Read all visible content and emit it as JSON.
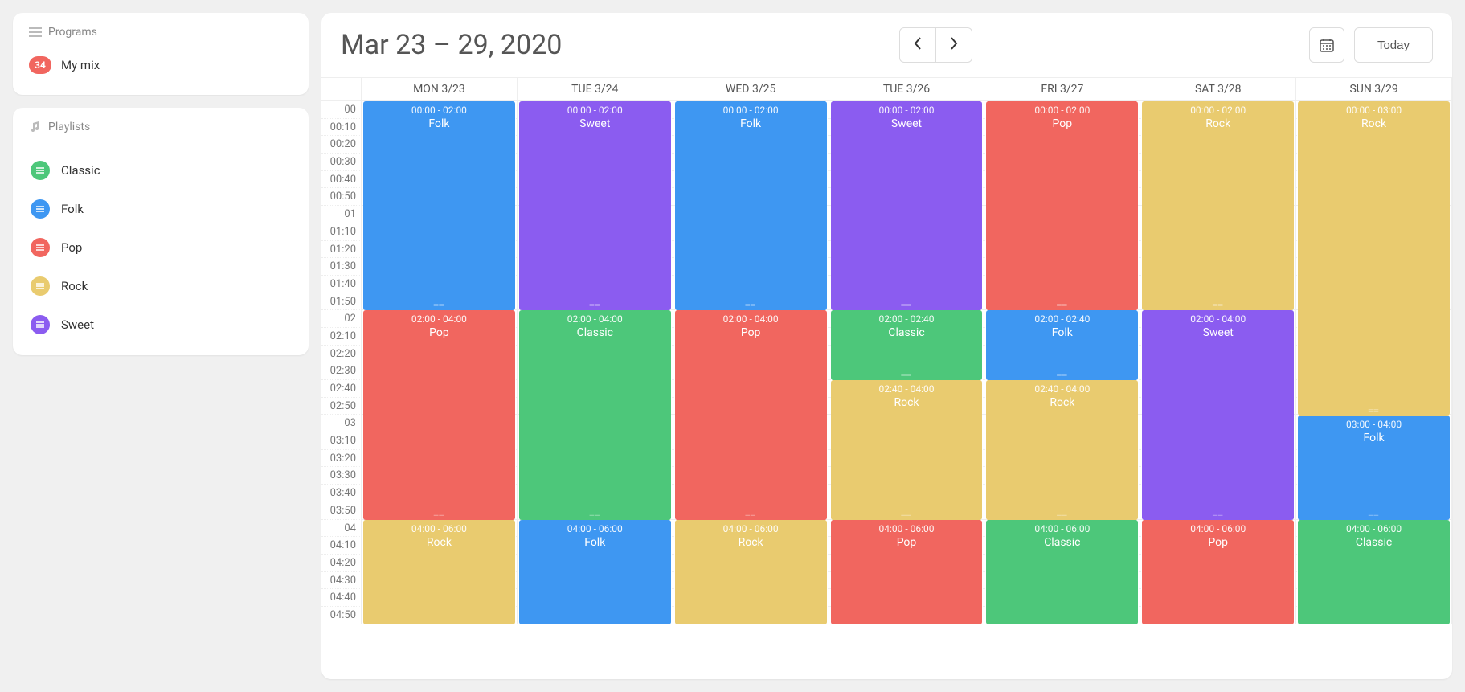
{
  "sidebar": {
    "programs_header": "Programs",
    "programs": [
      {
        "badge": "34",
        "label": "My mix"
      }
    ],
    "playlists_header": "Playlists",
    "playlists": [
      {
        "label": "Classic",
        "color": "#4dc77a"
      },
      {
        "label": "Folk",
        "color": "#3e97f2"
      },
      {
        "label": "Pop",
        "color": "#f1665f"
      },
      {
        "label": "Rock",
        "color": "#e9cb6f"
      },
      {
        "label": "Sweet",
        "color": "#8b5cf0"
      }
    ]
  },
  "calendar": {
    "range_title": "Mar 23 – 29, 2020",
    "today_label": "Today",
    "colors": {
      "Classic": "#4dc77a",
      "Folk": "#3e97f2",
      "Pop": "#f1665f",
      "Rock": "#e9cb6f",
      "Sweet": "#8b5cf0"
    },
    "days": [
      "MON 3/23",
      "TUE 3/24",
      "WED 3/25",
      "TUE 3/26",
      "FRI 3/27",
      "SAT 3/28",
      "SUN 3/29"
    ],
    "time_labels": [
      "00",
      "00:10",
      "00:20",
      "00:30",
      "00:40",
      "00:50",
      "01",
      "01:10",
      "01:20",
      "01:30",
      "01:40",
      "01:50",
      "02",
      "02:10",
      "02:20",
      "02:30",
      "02:40",
      "02:50",
      "03",
      "03:10",
      "03:20",
      "03:30",
      "03:40",
      "03:50",
      "04",
      "04:10",
      "04:20",
      "04:30",
      "04:40",
      "04:50"
    ],
    "minutes_visible": 300,
    "events": [
      {
        "day": 0,
        "start": 0,
        "end": 120,
        "time": "00:00 - 02:00",
        "label": "Folk"
      },
      {
        "day": 0,
        "start": 120,
        "end": 240,
        "time": "02:00 - 04:00",
        "label": "Pop"
      },
      {
        "day": 0,
        "start": 240,
        "end": 360,
        "time": "04:00 - 06:00",
        "label": "Rock"
      },
      {
        "day": 1,
        "start": 0,
        "end": 120,
        "time": "00:00 - 02:00",
        "label": "Sweet"
      },
      {
        "day": 1,
        "start": 120,
        "end": 240,
        "time": "02:00 - 04:00",
        "label": "Classic"
      },
      {
        "day": 1,
        "start": 240,
        "end": 360,
        "time": "04:00 - 06:00",
        "label": "Folk"
      },
      {
        "day": 2,
        "start": 0,
        "end": 120,
        "time": "00:00 - 02:00",
        "label": "Folk"
      },
      {
        "day": 2,
        "start": 120,
        "end": 240,
        "time": "02:00 - 04:00",
        "label": "Pop"
      },
      {
        "day": 2,
        "start": 240,
        "end": 360,
        "time": "04:00 - 06:00",
        "label": "Rock"
      },
      {
        "day": 3,
        "start": 0,
        "end": 120,
        "time": "00:00 - 02:00",
        "label": "Sweet"
      },
      {
        "day": 3,
        "start": 120,
        "end": 160,
        "time": "02:00 - 02:40",
        "label": "Classic"
      },
      {
        "day": 3,
        "start": 160,
        "end": 240,
        "time": "02:40 - 04:00",
        "label": "Rock"
      },
      {
        "day": 3,
        "start": 240,
        "end": 360,
        "time": "04:00 - 06:00",
        "label": "Pop"
      },
      {
        "day": 4,
        "start": 0,
        "end": 120,
        "time": "00:00 - 02:00",
        "label": "Pop"
      },
      {
        "day": 4,
        "start": 120,
        "end": 160,
        "time": "02:00 - 02:40",
        "label": "Folk"
      },
      {
        "day": 4,
        "start": 160,
        "end": 240,
        "time": "02:40 - 04:00",
        "label": "Rock"
      },
      {
        "day": 4,
        "start": 240,
        "end": 360,
        "time": "04:00 - 06:00",
        "label": "Classic"
      },
      {
        "day": 5,
        "start": 0,
        "end": 120,
        "time": "00:00 - 02:00",
        "label": "Rock"
      },
      {
        "day": 5,
        "start": 120,
        "end": 240,
        "time": "02:00 - 04:00",
        "label": "Sweet"
      },
      {
        "day": 5,
        "start": 240,
        "end": 360,
        "time": "04:00 - 06:00",
        "label": "Pop"
      },
      {
        "day": 6,
        "start": 0,
        "end": 180,
        "time": "00:00 - 03:00",
        "label": "Rock"
      },
      {
        "day": 6,
        "start": 180,
        "end": 240,
        "time": "03:00 - 04:00",
        "label": "Folk"
      },
      {
        "day": 6,
        "start": 240,
        "end": 360,
        "time": "04:00 - 06:00",
        "label": "Classic"
      }
    ]
  }
}
